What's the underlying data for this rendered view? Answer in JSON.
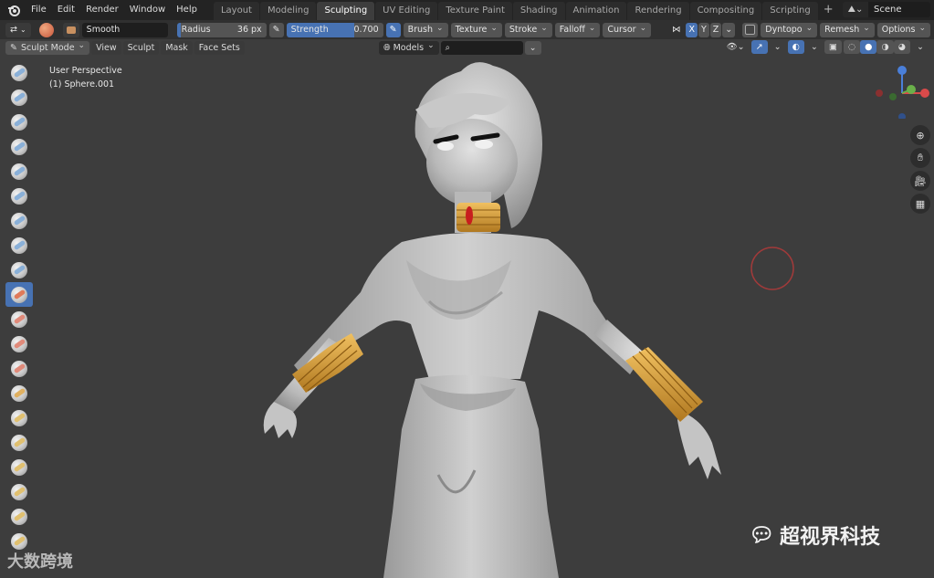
{
  "menu": {
    "items": [
      "File",
      "Edit",
      "Render",
      "Window",
      "Help"
    ]
  },
  "workspaces": {
    "tabs": [
      "Layout",
      "Modeling",
      "Sculpting",
      "UV Editing",
      "Texture Paint",
      "Shading",
      "Animation",
      "Rendering",
      "Compositing",
      "Scripting"
    ],
    "active": "Sculpting",
    "add": "+"
  },
  "scene": {
    "name": "Scene"
  },
  "tool_header": {
    "brush_name": "Smooth",
    "radius_label": "Radius",
    "radius_value": "36 px",
    "strength_label": "Strength",
    "strength_value": "0.700",
    "menus": [
      "Brush",
      "Texture",
      "Stroke",
      "Falloff",
      "Cursor"
    ],
    "axes": [
      "X",
      "Y",
      "Z"
    ],
    "dyntopo": "Dyntopo",
    "remesh": "Remesh",
    "options": "Options"
  },
  "mode_header": {
    "mode": "Sculpt Mode",
    "menus": [
      "View",
      "Sculpt",
      "Mask",
      "Face Sets"
    ],
    "models": "Models"
  },
  "viewport": {
    "perspective": "User Perspective",
    "object": "(1) Sphere.001"
  },
  "watermarks": {
    "left": "大数跨境",
    "right": "超视界科技"
  },
  "colors": {
    "accent": "#4772b3",
    "viewport_bg": "#3d3d3d",
    "header_bg": "#303030",
    "topbar_bg": "#232323",
    "gold": "#d9a23a"
  },
  "tools": [
    {
      "name": "draw-brush-icon"
    },
    {
      "name": "draw-sharp-brush-icon"
    },
    {
      "name": "clay-brush-icon"
    },
    {
      "name": "clay-strips-brush-icon"
    },
    {
      "name": "clay-thumb-brush-icon"
    },
    {
      "name": "layer-brush-icon"
    },
    {
      "name": "inflate-brush-icon"
    },
    {
      "name": "blob-brush-icon"
    },
    {
      "name": "crease-brush-icon"
    },
    {
      "name": "smooth-brush-icon"
    },
    {
      "name": "flatten-brush-icon"
    },
    {
      "name": "fill-brush-icon"
    },
    {
      "name": "scrape-brush-icon"
    },
    {
      "name": "multiplane-scrape-brush-icon"
    },
    {
      "name": "pinch-brush-icon"
    },
    {
      "name": "grab-brush-icon"
    },
    {
      "name": "elastic-deform-brush-icon"
    },
    {
      "name": "snake-hook-brush-icon"
    },
    {
      "name": "thumb-brush-icon"
    },
    {
      "name": "pose-brush-icon"
    }
  ]
}
